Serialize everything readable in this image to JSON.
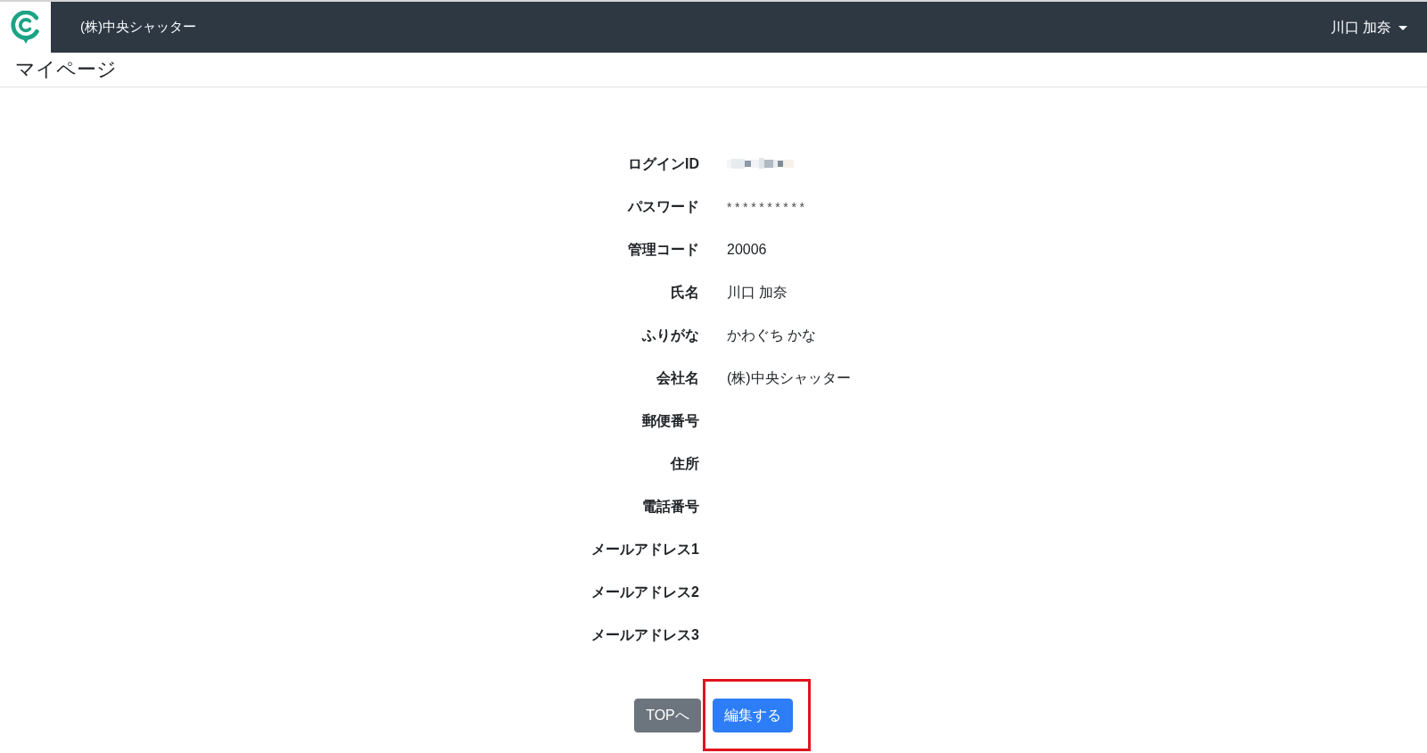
{
  "header": {
    "company": "(株)中央シャッター",
    "user_menu": "川口 加奈"
  },
  "page_title": "マイページ",
  "profile": {
    "fields": [
      {
        "label": "ログインID",
        "kind": "redacted"
      },
      {
        "label": "パスワード",
        "kind": "masked",
        "value": "**********"
      },
      {
        "label": "管理コード",
        "kind": "text",
        "value": "20006"
      },
      {
        "label": "氏名",
        "kind": "text",
        "value": "川口 加奈"
      },
      {
        "label": "ふりがな",
        "kind": "text",
        "value": "かわぐち かな"
      },
      {
        "label": "会社名",
        "kind": "text",
        "value": "(株)中央シャッター"
      },
      {
        "label": "郵便番号",
        "kind": "text"
      },
      {
        "label": "住所",
        "kind": "text"
      },
      {
        "label": "電話番号",
        "kind": "text"
      },
      {
        "label": "メールアドレス1",
        "kind": "text"
      },
      {
        "label": "メールアドレス2",
        "kind": "text"
      },
      {
        "label": "メールアドレス3",
        "kind": "text"
      }
    ]
  },
  "buttons": [
    {
      "label": "TOPへ",
      "kind": "secondary",
      "highlighted": false
    },
    {
      "label": "編集する",
      "kind": "primary",
      "highlighted": true
    }
  ]
}
